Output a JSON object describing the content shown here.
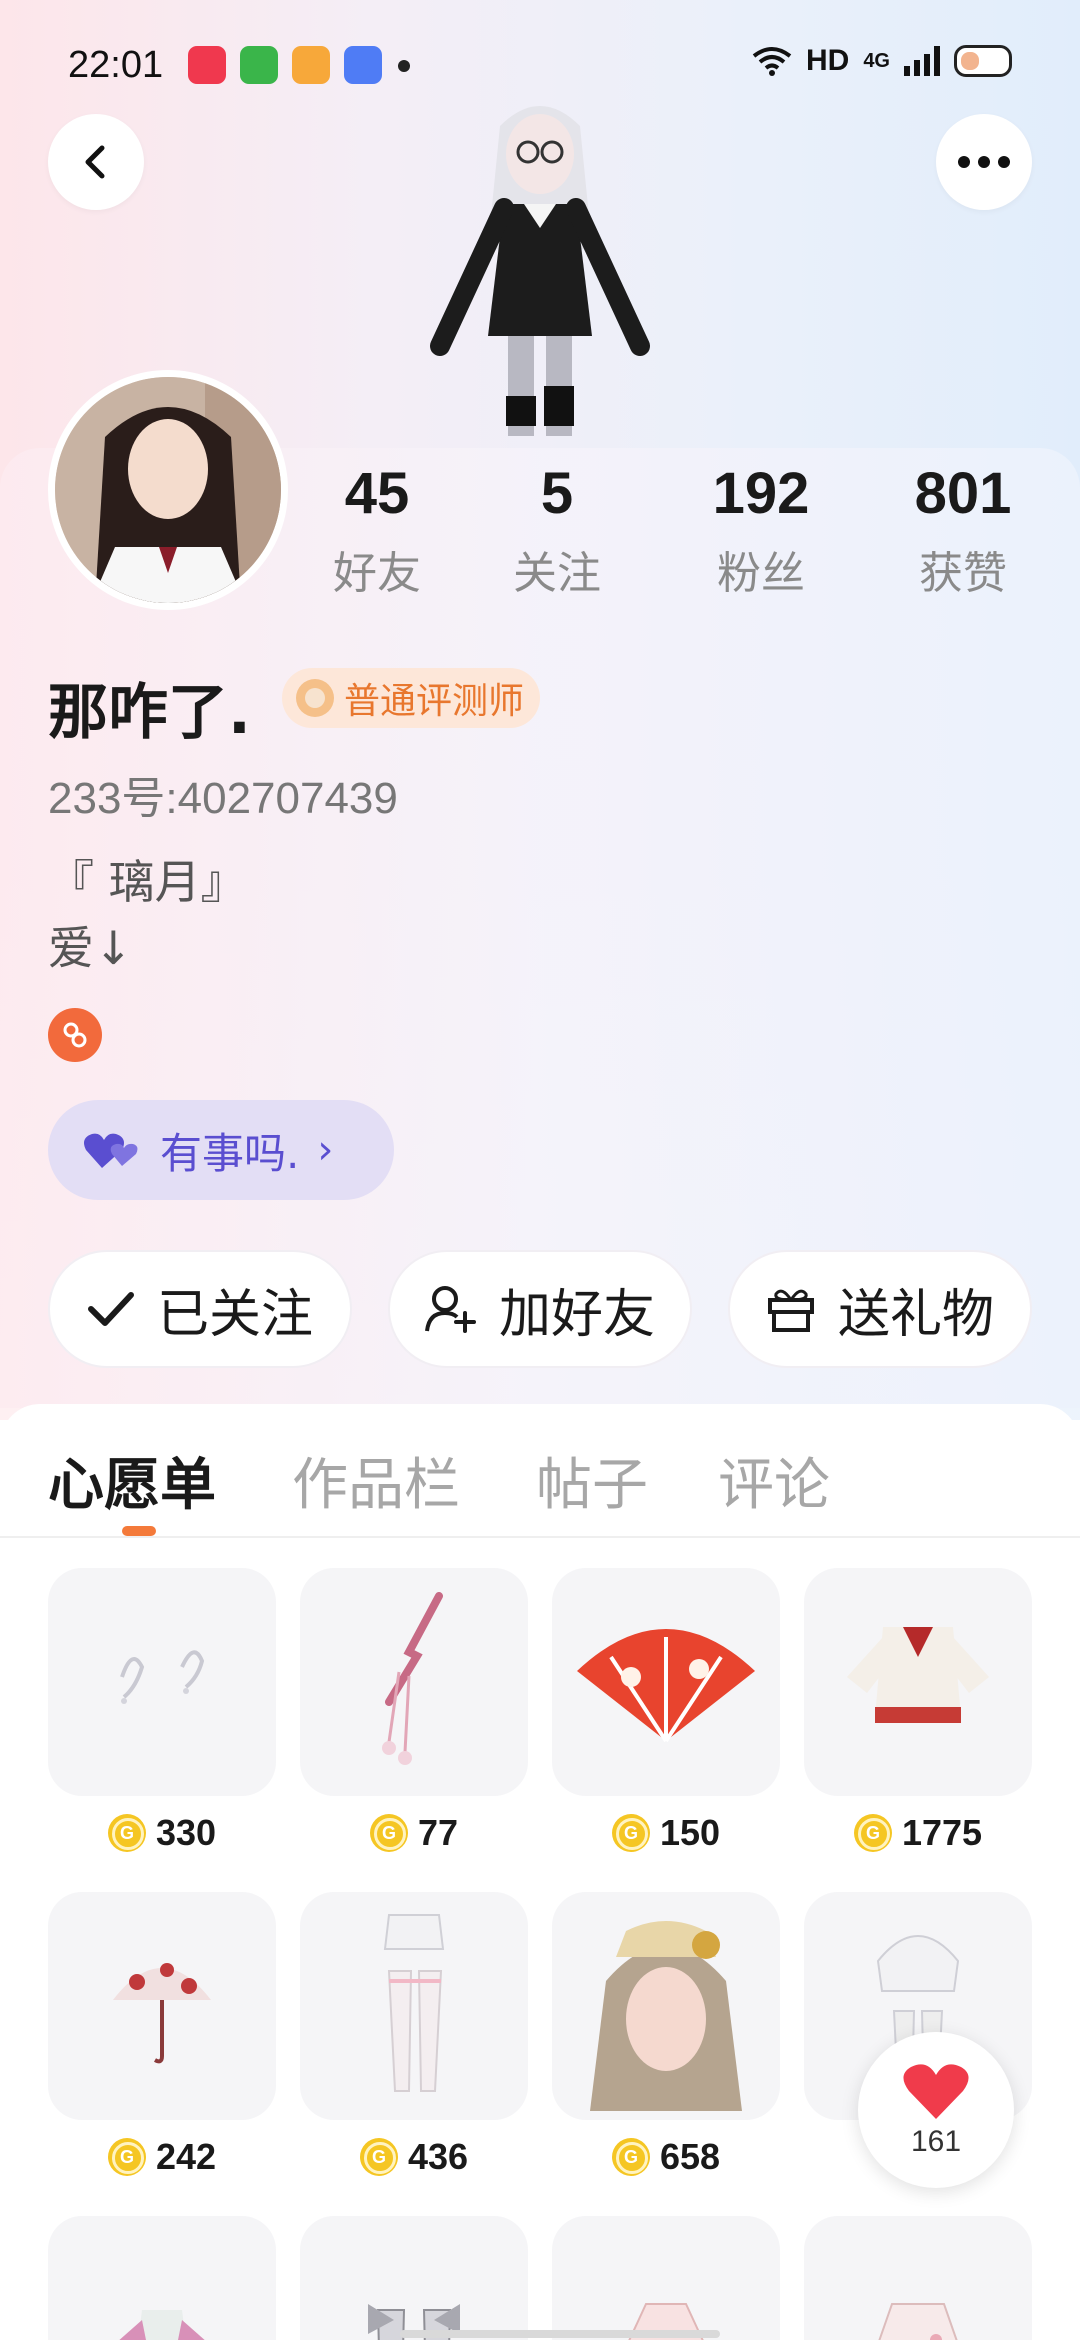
{
  "status_bar": {
    "time": "22:01",
    "network": "HD",
    "cellular": "4G",
    "apps": [
      {
        "icon": "music-app-icon",
        "color": "#f0384e"
      },
      {
        "icon": "shopping-app-icon",
        "color": "#3ab54a"
      },
      {
        "icon": "game-app-icon",
        "color": "#f7a83a"
      },
      {
        "icon": "photo-app-icon",
        "color": "#4f7cf5"
      }
    ]
  },
  "header": {
    "back_icon": "back-arrow-icon",
    "more_icon": "more-dots-icon"
  },
  "profile": {
    "stats": [
      {
        "value": "45",
        "label": "好友"
      },
      {
        "value": "5",
        "label": "关注"
      },
      {
        "value": "192",
        "label": "粉丝"
      },
      {
        "value": "801",
        "label": "获赞"
      }
    ],
    "name": "那咋了.",
    "badge": "普通评测师",
    "uid": "233号:402707439",
    "bio_line1": "『 璃月』",
    "bio_line2": "爱↓",
    "mood": "有事吗.",
    "mood_arrow": "›"
  },
  "actions": {
    "followed": "已关注",
    "add_friend": "加好友",
    "send_gift": "送礼物"
  },
  "tabs": [
    "心愿单",
    "作品栏",
    "帖子",
    "评论"
  ],
  "wishlist": [
    {
      "name": "ear-ornament",
      "price": "330"
    },
    {
      "name": "hair-pin",
      "price": "77"
    },
    {
      "name": "folding-fan",
      "price": "150"
    },
    {
      "name": "lolita-top",
      "price": "1775"
    },
    {
      "name": "parasol",
      "price": "242"
    },
    {
      "name": "stockings",
      "price": "436"
    },
    {
      "name": "wig",
      "price": "658"
    },
    {
      "name": "skirt-stockings",
      "price": ""
    }
  ],
  "like_float": {
    "count": "161"
  },
  "colors": {
    "accent": "#f47a3a",
    "badge_text": "#e8772e",
    "mood_text": "#5a4ed0",
    "coin": "#f5c623",
    "heart": "#f03b4b"
  }
}
